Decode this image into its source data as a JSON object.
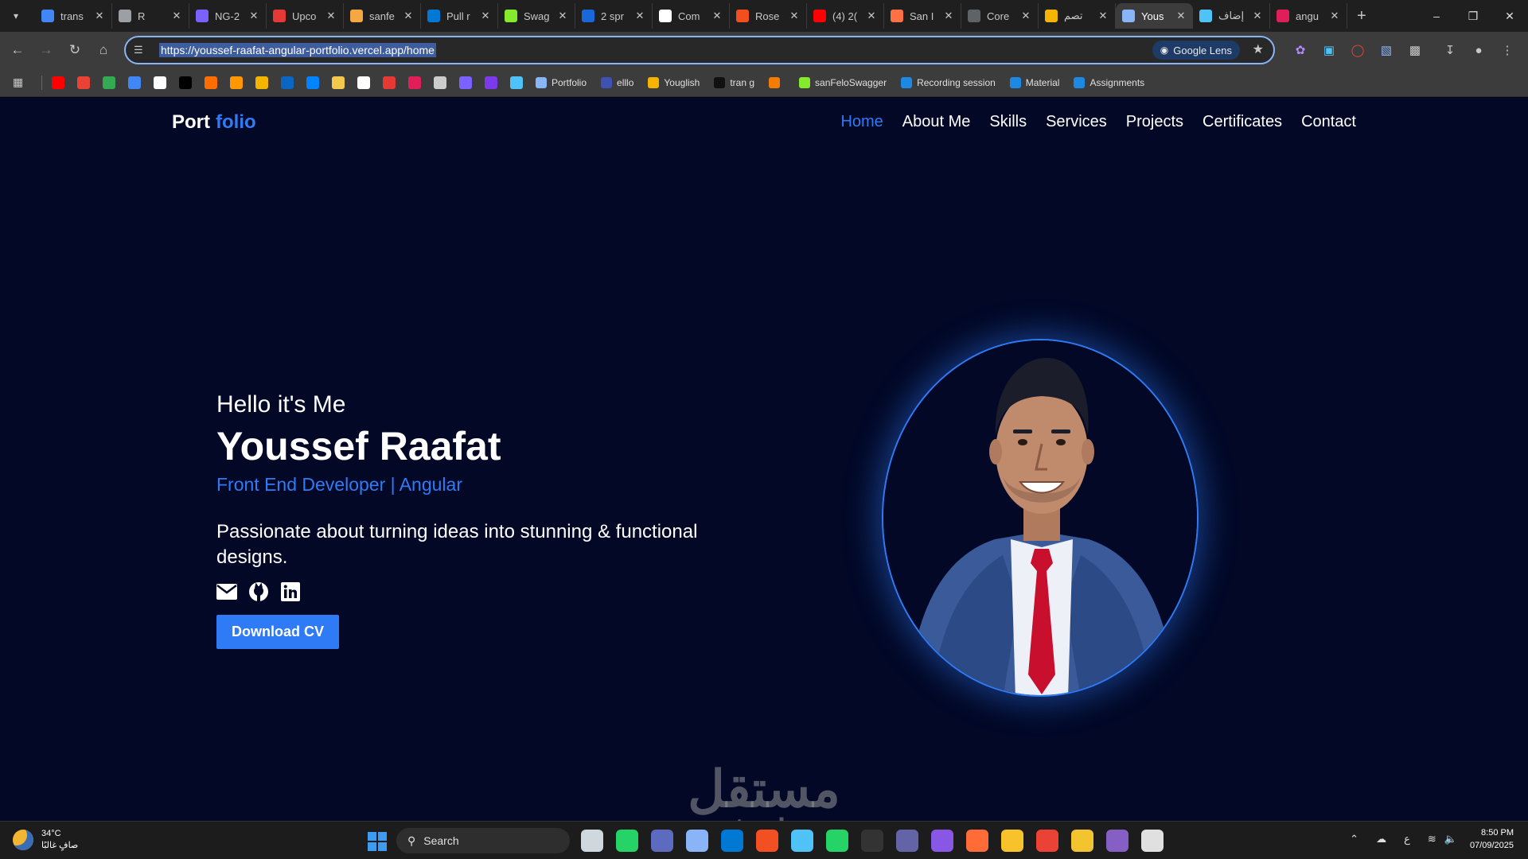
{
  "browser": {
    "tabs": [
      {
        "label": "trans",
        "color": "#4285f4",
        "icon": "google-icon"
      },
      {
        "label": "R",
        "color": "#9aa0a6",
        "icon": "openai-icon"
      },
      {
        "label": "NG-2",
        "color": "#7b61ff",
        "icon": "ng-icon"
      },
      {
        "label": "Upco",
        "color": "#e53935",
        "icon": "upcoming-icon"
      },
      {
        "label": "sanfe",
        "color": "#f4a742",
        "icon": "sanfe-icon"
      },
      {
        "label": "Pull r",
        "color": "#0078d4",
        "icon": "azure-devops-icon"
      },
      {
        "label": "Swag",
        "color": "#85ea2d",
        "icon": "swagger-icon"
      },
      {
        "label": "2 spr",
        "color": "#1868db",
        "icon": "jira-icon"
      },
      {
        "label": "Com",
        "color": "#ffffff",
        "icon": "github-icon"
      },
      {
        "label": "Rose",
        "color": "#f24e1e",
        "icon": "figma-icon"
      },
      {
        "label": "(4) 2(",
        "color": "#ff0000",
        "icon": "youtube-icon"
      },
      {
        "label": "San I",
        "color": "#ff7043",
        "icon": "profile-icon"
      },
      {
        "label": "Core",
        "color": "#5f6368",
        "icon": "core-icon"
      },
      {
        "label": "تصم",
        "color": "#f4b400",
        "icon": "mostaql-icon"
      },
      {
        "label": "Yous",
        "color": "#8ab4f8",
        "icon": "portfolio-icon",
        "active": true
      },
      {
        "label": "إضاف",
        "color": "#4fc3f7",
        "icon": "circle-icon"
      },
      {
        "label": "angu",
        "color": "#e01e5a",
        "icon": "slack-icon"
      }
    ],
    "url": "https://youssef-raafat-angular-portfolio.vercel.app/home",
    "lens_label": "Google Lens",
    "bookmark_icon_colors": [
      "#ff0000",
      "#ea4335",
      "#34a853",
      "#4285f4",
      "#ffffff",
      "#000000",
      "#ff6d00",
      "#ff9800",
      "#f4b400",
      "#0a66c2",
      "#0084ff",
      "#f2c94c",
      "#ffffff",
      "#e53935",
      "#e01e5a",
      "#cccccc",
      "#7b61ff",
      "#7c3aed",
      "#4fc3f7"
    ],
    "bookmarks": [
      {
        "label": "Portfolio",
        "color": "#8ab4f8"
      },
      {
        "label": "elllo",
        "color": "#3f51b5"
      },
      {
        "label": "Youglish",
        "color": "#f4b400"
      },
      {
        "label": "tran g",
        "color": "#111111"
      },
      {
        "label": "",
        "color": "#f57c00"
      },
      {
        "label": "sanFeloSwagger",
        "color": "#85ea2d"
      },
      {
        "label": "Recording session",
        "color": "#1e88e5"
      },
      {
        "label": "Material",
        "color": "#1e88e5"
      },
      {
        "label": "Assignments",
        "color": "#1e88e5"
      }
    ]
  },
  "page": {
    "brand_main": "Port",
    "brand_accent": "folio",
    "nav": [
      "Home",
      "About Me",
      "Skills",
      "Services",
      "Projects",
      "Certificates",
      "Contact"
    ],
    "active_nav": "Home",
    "hero": {
      "greeting": "Hello it's Me",
      "name": "Youssef Raafat",
      "role": "Front End Developer | Angular",
      "tagline": "Passionate about turning ideas into stunning & functional designs.",
      "socials": [
        "email-icon",
        "github-icon",
        "linkedin-icon"
      ],
      "cta": "Download CV"
    },
    "accent_color": "#2f7bf5",
    "background_color": "#020826",
    "watermark_ar": "مستقل",
    "watermark_en": "mostaql.com"
  },
  "taskbar": {
    "weather_temp": "34°C",
    "weather_desc": "صافٍ غالبًا",
    "search_placeholder": "Search",
    "apps": [
      {
        "icon": "desktop-icon",
        "color": "#cfd8dc"
      },
      {
        "icon": "whatsapp-icon",
        "color": "#25d366"
      },
      {
        "icon": "media-player-icon",
        "color": "#5c6bc0"
      },
      {
        "icon": "calculator-icon",
        "color": "#8ab4f8"
      },
      {
        "icon": "outlook-icon",
        "color": "#0078d4"
      },
      {
        "icon": "store-icon",
        "color": "#f25022"
      },
      {
        "icon": "notepad-icon",
        "color": "#4fc3f7"
      },
      {
        "icon": "whatsapp-icon",
        "color": "#25d366"
      },
      {
        "icon": "terminal-icon",
        "color": "#333333"
      },
      {
        "icon": "teams-icon",
        "color": "#6264a7"
      },
      {
        "icon": "github-desktop-icon",
        "color": "#8957e5"
      },
      {
        "icon": "postman-icon",
        "color": "#ff6c37"
      },
      {
        "icon": "file-explorer-icon",
        "color": "#f8c22b"
      },
      {
        "icon": "chrome-icon",
        "color": "#ea4335"
      },
      {
        "icon": "vscode-icon",
        "color": "#f4c430"
      },
      {
        "icon": "visual-studio-icon",
        "color": "#865fc5"
      },
      {
        "icon": "cursor-icon",
        "color": "#e0e0e0"
      }
    ],
    "lang": "ع",
    "time": "8:50 PM",
    "date": "07/09/2025"
  }
}
